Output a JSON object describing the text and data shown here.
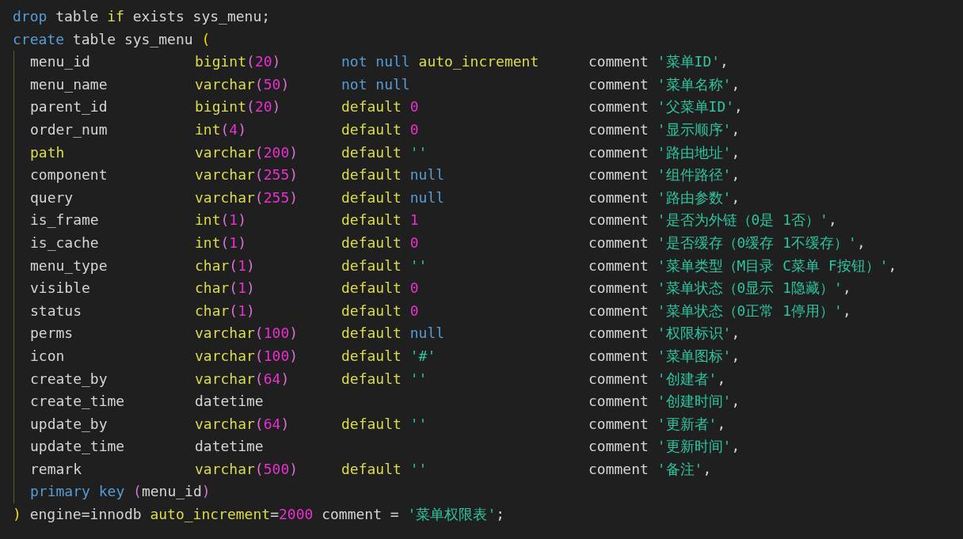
{
  "editor": {
    "lines_before": [
      [
        {
          "text": "drop ",
          "kind": "kw"
        },
        {
          "text": "table ",
          "kind": "txt"
        },
        {
          "text": "if ",
          "kind": "fn"
        },
        {
          "text": "exists sys_menu;",
          "kind": "txt"
        }
      ],
      [
        {
          "text": "create ",
          "kind": "kw"
        },
        {
          "text": "table sys_menu ",
          "kind": "txt"
        },
        {
          "text": "(",
          "kind": "p1"
        }
      ]
    ],
    "rows": [
      {
        "name": [
          {
            "text": "menu_id",
            "kind": "txt"
          }
        ],
        "type": [
          {
            "text": "bigint",
            "kind": "fn"
          },
          {
            "text": "(",
            "kind": "p2"
          },
          {
            "text": "20",
            "kind": "num"
          },
          {
            "text": ")",
            "kind": "p2"
          }
        ],
        "constraint": [
          {
            "text": "not ",
            "kind": "kw"
          },
          {
            "text": "null ",
            "kind": "kw"
          },
          {
            "text": "auto_increment",
            "kind": "fn"
          }
        ],
        "comment": [
          {
            "text": "comment ",
            "kind": "txt"
          },
          {
            "text": "'菜单ID'",
            "kind": "str"
          },
          {
            "text": ",",
            "kind": "txt"
          }
        ]
      },
      {
        "name": [
          {
            "text": "menu_name",
            "kind": "txt"
          }
        ],
        "type": [
          {
            "text": "varchar",
            "kind": "fn"
          },
          {
            "text": "(",
            "kind": "p2"
          },
          {
            "text": "50",
            "kind": "num"
          },
          {
            "text": ")",
            "kind": "p2"
          }
        ],
        "constraint": [
          {
            "text": "not ",
            "kind": "kw"
          },
          {
            "text": "null",
            "kind": "kw"
          }
        ],
        "comment": [
          {
            "text": "comment ",
            "kind": "txt"
          },
          {
            "text": "'菜单名称'",
            "kind": "str"
          },
          {
            "text": ",",
            "kind": "txt"
          }
        ]
      },
      {
        "name": [
          {
            "text": "parent_id",
            "kind": "txt"
          }
        ],
        "type": [
          {
            "text": "bigint",
            "kind": "fn"
          },
          {
            "text": "(",
            "kind": "p2"
          },
          {
            "text": "20",
            "kind": "num"
          },
          {
            "text": ")",
            "kind": "p2"
          }
        ],
        "constraint": [
          {
            "text": "default ",
            "kind": "fn"
          },
          {
            "text": "0",
            "kind": "num"
          }
        ],
        "comment": [
          {
            "text": "comment ",
            "kind": "txt"
          },
          {
            "text": "'父菜单ID'",
            "kind": "str"
          },
          {
            "text": ",",
            "kind": "txt"
          }
        ]
      },
      {
        "name": [
          {
            "text": "order_num",
            "kind": "txt"
          }
        ],
        "type": [
          {
            "text": "int",
            "kind": "fn"
          },
          {
            "text": "(",
            "kind": "p2"
          },
          {
            "text": "4",
            "kind": "num"
          },
          {
            "text": ")",
            "kind": "p2"
          }
        ],
        "constraint": [
          {
            "text": "default ",
            "kind": "fn"
          },
          {
            "text": "0",
            "kind": "num"
          }
        ],
        "comment": [
          {
            "text": "comment ",
            "kind": "txt"
          },
          {
            "text": "'显示顺序'",
            "kind": "str"
          },
          {
            "text": ",",
            "kind": "txt"
          }
        ]
      },
      {
        "name": [
          {
            "text": "path",
            "kind": "fn"
          }
        ],
        "type": [
          {
            "text": "varchar",
            "kind": "fn"
          },
          {
            "text": "(",
            "kind": "p2"
          },
          {
            "text": "200",
            "kind": "num"
          },
          {
            "text": ")",
            "kind": "p2"
          }
        ],
        "constraint": [
          {
            "text": "default ",
            "kind": "fn"
          },
          {
            "text": "''",
            "kind": "str"
          }
        ],
        "comment": [
          {
            "text": "comment ",
            "kind": "txt"
          },
          {
            "text": "'路由地址'",
            "kind": "str"
          },
          {
            "text": ",",
            "kind": "txt"
          }
        ]
      },
      {
        "name": [
          {
            "text": "component",
            "kind": "txt"
          }
        ],
        "type": [
          {
            "text": "varchar",
            "kind": "fn"
          },
          {
            "text": "(",
            "kind": "p2"
          },
          {
            "text": "255",
            "kind": "num"
          },
          {
            "text": ")",
            "kind": "p2"
          }
        ],
        "constraint": [
          {
            "text": "default ",
            "kind": "fn"
          },
          {
            "text": "null",
            "kind": "kw"
          }
        ],
        "comment": [
          {
            "text": "comment ",
            "kind": "txt"
          },
          {
            "text": "'组件路径'",
            "kind": "str"
          },
          {
            "text": ",",
            "kind": "txt"
          }
        ]
      },
      {
        "name": [
          {
            "text": "query",
            "kind": "txt"
          }
        ],
        "type": [
          {
            "text": "varchar",
            "kind": "fn"
          },
          {
            "text": "(",
            "kind": "p2"
          },
          {
            "text": "255",
            "kind": "num"
          },
          {
            "text": ")",
            "kind": "p2"
          }
        ],
        "constraint": [
          {
            "text": "default ",
            "kind": "fn"
          },
          {
            "text": "null",
            "kind": "kw"
          }
        ],
        "comment": [
          {
            "text": "comment ",
            "kind": "txt"
          },
          {
            "text": "'路由参数'",
            "kind": "str"
          },
          {
            "text": ",",
            "kind": "txt"
          }
        ]
      },
      {
        "name": [
          {
            "text": "is_frame",
            "kind": "txt"
          }
        ],
        "type": [
          {
            "text": "int",
            "kind": "fn"
          },
          {
            "text": "(",
            "kind": "p2"
          },
          {
            "text": "1",
            "kind": "num"
          },
          {
            "text": ")",
            "kind": "p2"
          }
        ],
        "constraint": [
          {
            "text": "default ",
            "kind": "fn"
          },
          {
            "text": "1",
            "kind": "num"
          }
        ],
        "comment": [
          {
            "text": "comment ",
            "kind": "txt"
          },
          {
            "text": "'是否为外链（0是 1否）'",
            "kind": "str"
          },
          {
            "text": ",",
            "kind": "txt"
          }
        ]
      },
      {
        "name": [
          {
            "text": "is_cache",
            "kind": "txt"
          }
        ],
        "type": [
          {
            "text": "int",
            "kind": "fn"
          },
          {
            "text": "(",
            "kind": "p2"
          },
          {
            "text": "1",
            "kind": "num"
          },
          {
            "text": ")",
            "kind": "p2"
          }
        ],
        "constraint": [
          {
            "text": "default ",
            "kind": "fn"
          },
          {
            "text": "0",
            "kind": "num"
          }
        ],
        "comment": [
          {
            "text": "comment ",
            "kind": "txt"
          },
          {
            "text": "'是否缓存（0缓存 1不缓存）'",
            "kind": "str"
          },
          {
            "text": ",",
            "kind": "txt"
          }
        ]
      },
      {
        "name": [
          {
            "text": "menu_type",
            "kind": "txt"
          }
        ],
        "type": [
          {
            "text": "char",
            "kind": "fn"
          },
          {
            "text": "(",
            "kind": "p2"
          },
          {
            "text": "1",
            "kind": "num"
          },
          {
            "text": ")",
            "kind": "p2"
          }
        ],
        "constraint": [
          {
            "text": "default ",
            "kind": "fn"
          },
          {
            "text": "''",
            "kind": "str"
          }
        ],
        "comment": [
          {
            "text": "comment ",
            "kind": "txt"
          },
          {
            "text": "'菜单类型（M目录 C菜单 F按钮）'",
            "kind": "str"
          },
          {
            "text": ",",
            "kind": "txt"
          }
        ]
      },
      {
        "name": [
          {
            "text": "visible",
            "kind": "txt"
          }
        ],
        "type": [
          {
            "text": "char",
            "kind": "fn"
          },
          {
            "text": "(",
            "kind": "p2"
          },
          {
            "text": "1",
            "kind": "num"
          },
          {
            "text": ")",
            "kind": "p2"
          }
        ],
        "constraint": [
          {
            "text": "default ",
            "kind": "fn"
          },
          {
            "text": "0",
            "kind": "num"
          }
        ],
        "comment": [
          {
            "text": "comment ",
            "kind": "txt"
          },
          {
            "text": "'菜单状态（0显示 1隐藏）'",
            "kind": "str"
          },
          {
            "text": ",",
            "kind": "txt"
          }
        ]
      },
      {
        "name": [
          {
            "text": "status",
            "kind": "txt"
          }
        ],
        "type": [
          {
            "text": "char",
            "kind": "fn"
          },
          {
            "text": "(",
            "kind": "p2"
          },
          {
            "text": "1",
            "kind": "num"
          },
          {
            "text": ")",
            "kind": "p2"
          }
        ],
        "constraint": [
          {
            "text": "default ",
            "kind": "fn"
          },
          {
            "text": "0",
            "kind": "num"
          }
        ],
        "comment": [
          {
            "text": "comment ",
            "kind": "txt"
          },
          {
            "text": "'菜单状态（0正常 1停用）'",
            "kind": "str"
          },
          {
            "text": ",",
            "kind": "txt"
          }
        ]
      },
      {
        "name": [
          {
            "text": "perms",
            "kind": "txt"
          }
        ],
        "type": [
          {
            "text": "varchar",
            "kind": "fn"
          },
          {
            "text": "(",
            "kind": "p2"
          },
          {
            "text": "100",
            "kind": "num"
          },
          {
            "text": ")",
            "kind": "p2"
          }
        ],
        "constraint": [
          {
            "text": "default ",
            "kind": "fn"
          },
          {
            "text": "null",
            "kind": "kw"
          }
        ],
        "comment": [
          {
            "text": "comment ",
            "kind": "txt"
          },
          {
            "text": "'权限标识'",
            "kind": "str"
          },
          {
            "text": ",",
            "kind": "txt"
          }
        ]
      },
      {
        "name": [
          {
            "text": "icon",
            "kind": "txt"
          }
        ],
        "type": [
          {
            "text": "varchar",
            "kind": "fn"
          },
          {
            "text": "(",
            "kind": "p2"
          },
          {
            "text": "100",
            "kind": "num"
          },
          {
            "text": ")",
            "kind": "p2"
          }
        ],
        "constraint": [
          {
            "text": "default ",
            "kind": "fn"
          },
          {
            "text": "'#'",
            "kind": "str"
          }
        ],
        "comment": [
          {
            "text": "comment ",
            "kind": "txt"
          },
          {
            "text": "'菜单图标'",
            "kind": "str"
          },
          {
            "text": ",",
            "kind": "txt"
          }
        ]
      },
      {
        "name": [
          {
            "text": "create_by",
            "kind": "txt"
          }
        ],
        "type": [
          {
            "text": "varchar",
            "kind": "fn"
          },
          {
            "text": "(",
            "kind": "p2"
          },
          {
            "text": "64",
            "kind": "num"
          },
          {
            "text": ")",
            "kind": "p2"
          }
        ],
        "constraint": [
          {
            "text": "default ",
            "kind": "fn"
          },
          {
            "text": "''",
            "kind": "str"
          }
        ],
        "comment": [
          {
            "text": "comment ",
            "kind": "txt"
          },
          {
            "text": "'创建者'",
            "kind": "str"
          },
          {
            "text": ",",
            "kind": "txt"
          }
        ]
      },
      {
        "name": [
          {
            "text": "create_time",
            "kind": "txt"
          }
        ],
        "type": [
          {
            "text": "datetime",
            "kind": "txt"
          }
        ],
        "constraint": [],
        "comment": [
          {
            "text": "comment ",
            "kind": "txt"
          },
          {
            "text": "'创建时间'",
            "kind": "str"
          },
          {
            "text": ",",
            "kind": "txt"
          }
        ]
      },
      {
        "name": [
          {
            "text": "update_by",
            "kind": "txt"
          }
        ],
        "type": [
          {
            "text": "varchar",
            "kind": "fn"
          },
          {
            "text": "(",
            "kind": "p2"
          },
          {
            "text": "64",
            "kind": "num"
          },
          {
            "text": ")",
            "kind": "p2"
          }
        ],
        "constraint": [
          {
            "text": "default ",
            "kind": "fn"
          },
          {
            "text": "''",
            "kind": "str"
          }
        ],
        "comment": [
          {
            "text": "comment ",
            "kind": "txt"
          },
          {
            "text": "'更新者'",
            "kind": "str"
          },
          {
            "text": ",",
            "kind": "txt"
          }
        ]
      },
      {
        "name": [
          {
            "text": "update_time",
            "kind": "txt"
          }
        ],
        "type": [
          {
            "text": "datetime",
            "kind": "txt"
          }
        ],
        "constraint": [],
        "comment": [
          {
            "text": "comment ",
            "kind": "txt"
          },
          {
            "text": "'更新时间'",
            "kind": "str"
          },
          {
            "text": ",",
            "kind": "txt"
          }
        ]
      },
      {
        "name": [
          {
            "text": "remark",
            "kind": "txt"
          }
        ],
        "type": [
          {
            "text": "varchar",
            "kind": "fn"
          },
          {
            "text": "(",
            "kind": "p2"
          },
          {
            "text": "500",
            "kind": "num"
          },
          {
            "text": ")",
            "kind": "p2"
          }
        ],
        "constraint": [
          {
            "text": "default ",
            "kind": "fn"
          },
          {
            "text": "''",
            "kind": "str"
          }
        ],
        "comment": [
          {
            "text": "comment ",
            "kind": "txt"
          },
          {
            "text": "'备注'",
            "kind": "str"
          },
          {
            "text": ",",
            "kind": "txt"
          }
        ]
      }
    ],
    "key_line": [
      {
        "text": "primary ",
        "kind": "kw"
      },
      {
        "text": "key ",
        "kind": "kw"
      },
      {
        "text": "(",
        "kind": "p2"
      },
      {
        "text": "menu_id",
        "kind": "txt"
      },
      {
        "text": ")",
        "kind": "p2"
      }
    ],
    "lines_after": [
      [
        {
          "text": ") ",
          "kind": "p1"
        },
        {
          "text": "engine=innodb ",
          "kind": "txt"
        },
        {
          "text": "auto_increment",
          "kind": "fn"
        },
        {
          "text": "=",
          "kind": "txt"
        },
        {
          "text": "2000",
          "kind": "num"
        },
        {
          "text": " comment = ",
          "kind": "txt"
        },
        {
          "text": "'菜单权限表'",
          "kind": "str"
        },
        {
          "text": ";",
          "kind": "txt"
        }
      ]
    ]
  }
}
